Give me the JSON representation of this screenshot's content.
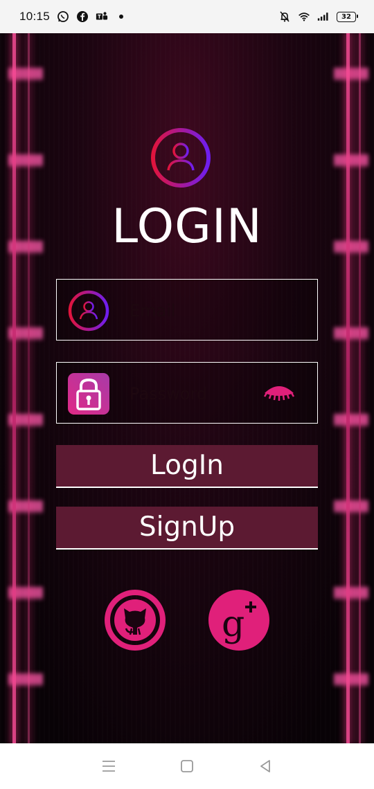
{
  "status_bar": {
    "time": "10:15",
    "battery": "32",
    "icons_left": [
      "whatsapp-icon",
      "facebook-icon",
      "teams-icon",
      "dot-icon"
    ],
    "icons_right": [
      "mute-bell-icon",
      "wifi-icon",
      "signal-icon",
      "battery-icon"
    ]
  },
  "screen": {
    "title": "LOGIN",
    "email_placeholder": "Email",
    "password_placeholder": "Password",
    "login_button": "LogIn",
    "signup_button": "SignUp"
  },
  "social": [
    "github-icon",
    "google-plus-icon"
  ],
  "nav": [
    "menu-icon",
    "home-square-icon",
    "back-triangle-icon"
  ],
  "colors": {
    "accent_pink": "#e0207a",
    "button_bg": "#5c1a32",
    "gradient_start": "#e0143c",
    "gradient_end": "#6e1ef0",
    "lock_bg_start": "#e02a86",
    "lock_bg_end": "#a83aa8"
  }
}
